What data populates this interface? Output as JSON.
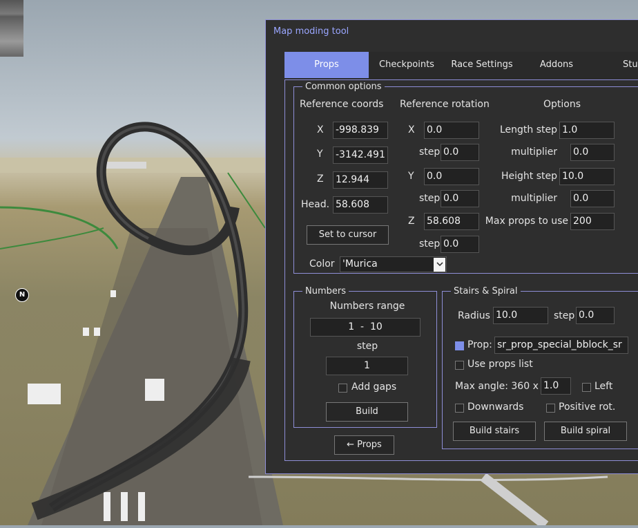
{
  "window": {
    "title": "Map moding tool"
  },
  "tabs": [
    {
      "label": "Props",
      "active": true
    },
    {
      "label": "Checkpoints"
    },
    {
      "label": "Race Settings"
    },
    {
      "label": "Addons"
    },
    {
      "label": "Stuff"
    }
  ],
  "common": {
    "legend": "Common options",
    "ref_coords": {
      "header": "Reference coords",
      "x_label": "X",
      "x_value": "-998.839",
      "y_label": "Y",
      "y_value": "-3142.491",
      "z_label": "Z",
      "z_value": "12.944",
      "head_label": "Head.",
      "head_value": "58.608",
      "set_cursor": "Set to cursor"
    },
    "ref_rotation": {
      "header": "Reference rotation",
      "x_label": "X",
      "x_value": "0.0",
      "x_step_label": "step",
      "x_step_value": "0.0",
      "y_label": "Y",
      "y_value": "0.0",
      "y_step_label": "step",
      "y_step_value": "0.0",
      "z_label": "Z",
      "z_value": "58.608",
      "z_step_label": "step",
      "z_step_value": "0.0"
    },
    "options": {
      "header": "Options",
      "length_step_label": "Length step",
      "length_step_value": "1.0",
      "length_mult_label": "multiplier",
      "length_mult_value": "0.0",
      "height_step_label": "Height step",
      "height_step_value": "10.0",
      "height_mult_label": "multiplier",
      "height_mult_value": "0.0",
      "max_props_label": "Max props to use",
      "max_props_value": "200"
    },
    "color_label": "Color",
    "color_value": "'Murica"
  },
  "numbers": {
    "legend": "Numbers",
    "range_label": "Numbers range",
    "range_value": "1  -  10",
    "step_label": "step",
    "step_value": "1",
    "add_gaps_label": "Add gaps",
    "add_gaps_checked": false,
    "build_label": "Build"
  },
  "stairs": {
    "legend": "Stairs & Spiral",
    "radius_label": "Radius",
    "radius_value": "10.0",
    "step_label": "step",
    "step_value": "0.0",
    "prop_label": "Prop:",
    "prop_checked": true,
    "prop_value": "sr_prop_special_bblock_sr",
    "use_props_list_label": "Use props list",
    "use_props_list_checked": false,
    "max_angle_label": "Max angle: 360 x",
    "max_angle_value": "1.0",
    "left_label": "Left",
    "left_checked": false,
    "downwards_label": "Downwards",
    "downwards_checked": false,
    "positive_rot_label": "Positive rot.",
    "positive_rot_checked": false,
    "build_stairs_label": "Build stairs",
    "build_spiral_label": "Build spiral"
  },
  "back_button_label": "← Props",
  "map_compass": "N",
  "colors": {
    "accent": "#7d8ee8",
    "border": "#8f8fd8",
    "panel": "#2e2e2e",
    "title": "#9aa6ff"
  }
}
